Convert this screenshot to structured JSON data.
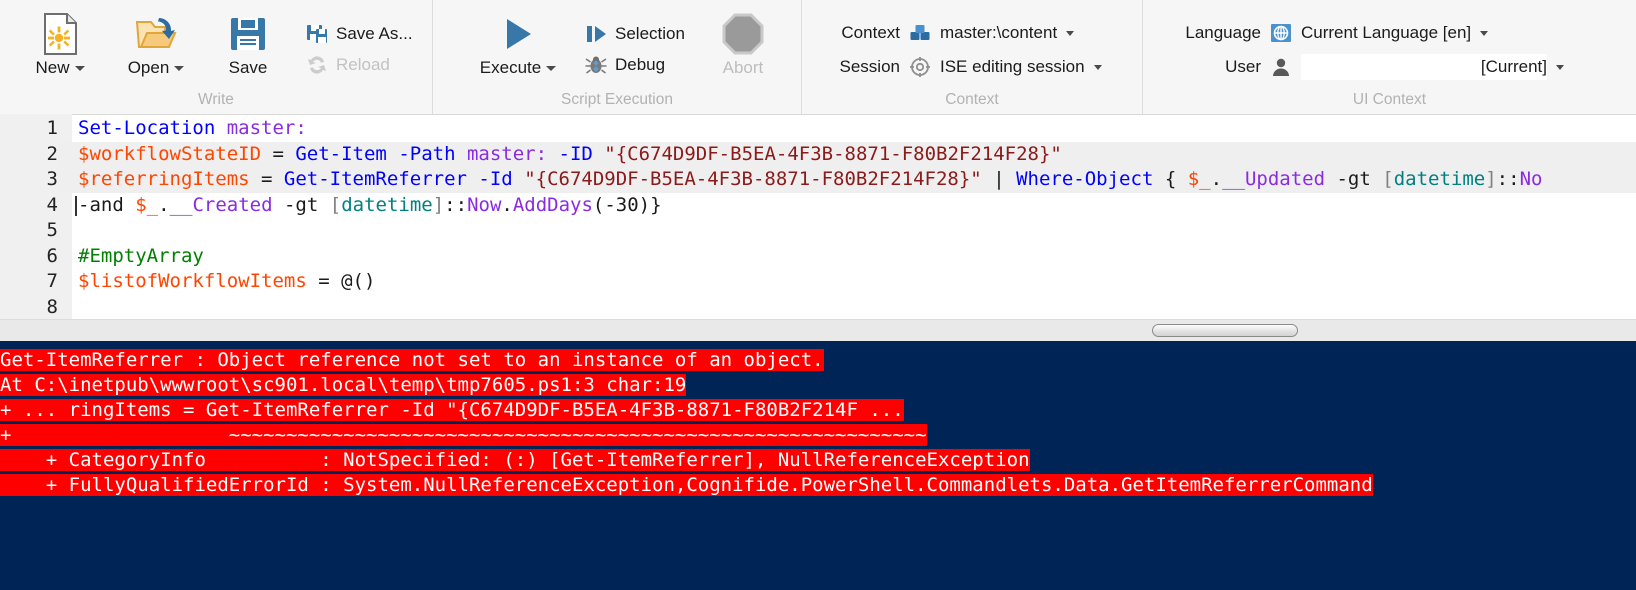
{
  "ribbon": {
    "groups": [
      {
        "name": "write",
        "label": "Write",
        "big_buttons": [
          {
            "caption": "New",
            "icon": "new-file-icon",
            "has_caret": true
          },
          {
            "caption": "Open",
            "icon": "open-folder-icon",
            "has_caret": true
          },
          {
            "caption": "Save",
            "icon": "save-disk-icon",
            "has_caret": false
          }
        ],
        "small_buttons": [
          {
            "caption": "Save As...",
            "icon": "save-as-icon",
            "disabled": false
          },
          {
            "caption": "Reload",
            "icon": "reload-icon",
            "disabled": true
          }
        ]
      },
      {
        "name": "script-execution",
        "label": "Script Execution",
        "big_buttons": [
          {
            "caption": "Execute",
            "icon": "play-icon",
            "has_caret": true
          }
        ],
        "small_buttons": [
          {
            "caption": "Selection",
            "icon": "selection-icon",
            "disabled": false
          },
          {
            "caption": "Debug",
            "icon": "bug-icon",
            "disabled": false
          }
        ],
        "abort": {
          "caption": "Abort",
          "icon": "abort-octagon-icon",
          "disabled": true
        }
      },
      {
        "name": "context",
        "label": "Context",
        "rows": [
          {
            "label": "Context",
            "icon": "database-blocks-icon",
            "value": "master:\\content",
            "has_caret": true
          },
          {
            "label": "Session",
            "icon": "target-icon",
            "value": "ISE editing session",
            "has_caret": true
          }
        ]
      },
      {
        "name": "ui-context",
        "label": "UI Context",
        "rows": [
          {
            "label": "Language",
            "icon": "globe-icon",
            "value": "Current Language [en]",
            "has_caret": true
          },
          {
            "label": "User",
            "icon": "user-icon",
            "value": "[Current]",
            "has_caret": true
          }
        ]
      }
    ]
  },
  "editor": {
    "lines": [
      {
        "number": "1",
        "highlight": false,
        "tokens": [
          {
            "t": "Set-Location",
            "c": "t-cmd"
          },
          {
            "t": " ",
            "c": "t-op"
          },
          {
            "t": "master:",
            "c": "t-par"
          }
        ]
      },
      {
        "number": "2",
        "highlight": true,
        "tokens": [
          {
            "t": "$workflowStateID",
            "c": "t-var"
          },
          {
            "t": " = ",
            "c": "t-op"
          },
          {
            "t": "Get-Item",
            "c": "t-cmd"
          },
          {
            "t": " ",
            "c": "t-op"
          },
          {
            "t": "-Path",
            "c": "t-cmd"
          },
          {
            "t": " ",
            "c": "t-op"
          },
          {
            "t": "master:",
            "c": "t-par"
          },
          {
            "t": " ",
            "c": "t-op"
          },
          {
            "t": "-ID",
            "c": "t-cmd"
          },
          {
            "t": " ",
            "c": "t-op"
          },
          {
            "t": "\"{C674D9DF-B5EA-4F3B-8871-F80B2F214F28}\"",
            "c": "t-str"
          }
        ]
      },
      {
        "number": "3",
        "highlight": true,
        "tokens": [
          {
            "t": "$referringItems",
            "c": "t-var"
          },
          {
            "t": " = ",
            "c": "t-op"
          },
          {
            "t": "Get-ItemReferrer",
            "c": "t-cmd"
          },
          {
            "t": " ",
            "c": "t-op"
          },
          {
            "t": "-Id",
            "c": "t-cmd"
          },
          {
            "t": " ",
            "c": "t-op"
          },
          {
            "t": "\"{C674D9DF-B5EA-4F3B-8871-F80B2F214F28}\"",
            "c": "t-str"
          },
          {
            "t": " ",
            "c": "t-op"
          },
          {
            "t": "|",
            "c": "t-pipe"
          },
          {
            "t": " ",
            "c": "t-op"
          },
          {
            "t": "Where-Object",
            "c": "t-cmd"
          },
          {
            "t": " { ",
            "c": "t-op"
          },
          {
            "t": "$_",
            "c": "t-var"
          },
          {
            "t": ".",
            "c": "t-op"
          },
          {
            "t": "__Updated",
            "c": "t-par"
          },
          {
            "t": " ",
            "c": "t-op"
          },
          {
            "t": "-gt",
            "c": "t-op"
          },
          {
            "t": " ",
            "c": "t-op"
          },
          {
            "t": "[",
            "c": "t-brk"
          },
          {
            "t": "datetime",
            "c": "t-type"
          },
          {
            "t": "]",
            "c": "t-brk"
          },
          {
            "t": "::",
            "c": "t-op"
          },
          {
            "t": "No",
            "c": "t-par"
          }
        ]
      },
      {
        "number": "4",
        "highlight": false,
        "tokens": [
          {
            "t": "-and",
            "c": "t-op"
          },
          {
            "t": " ",
            "c": "t-op"
          },
          {
            "t": "$_",
            "c": "t-var"
          },
          {
            "t": ".",
            "c": "t-op"
          },
          {
            "t": "__Created",
            "c": "t-par"
          },
          {
            "t": " ",
            "c": "t-op"
          },
          {
            "t": "-gt",
            "c": "t-op"
          },
          {
            "t": " ",
            "c": "t-op"
          },
          {
            "t": "[",
            "c": "t-brk"
          },
          {
            "t": "datetime",
            "c": "t-type"
          },
          {
            "t": "]",
            "c": "t-brk"
          },
          {
            "t": "::",
            "c": "t-op"
          },
          {
            "t": "Now",
            "c": "t-par"
          },
          {
            "t": ".",
            "c": "t-op"
          },
          {
            "t": "AddDays",
            "c": "t-par"
          },
          {
            "t": "(-30)}",
            "c": "t-op"
          }
        ]
      },
      {
        "number": "5",
        "highlight": false,
        "tokens": []
      },
      {
        "number": "6",
        "highlight": false,
        "tokens": [
          {
            "t": "#EmptyArray",
            "c": "t-com"
          }
        ]
      },
      {
        "number": "7",
        "highlight": false,
        "tokens": [
          {
            "t": "$listofWorkflowItems",
            "c": "t-var"
          },
          {
            "t": " = ",
            "c": "t-op"
          },
          {
            "t": "@()",
            "c": "t-op"
          }
        ]
      },
      {
        "number": "8",
        "highlight": false,
        "tokens": []
      }
    ]
  },
  "console": {
    "background_color": "#012456",
    "error_background_color": "#ff0000",
    "error_text_color": "#ffffff",
    "lines": [
      "Get-ItemReferrer : Object reference not set to an instance of an object.",
      "At C:\\inetpub\\wwwroot\\sc901.local\\temp\\tmp7605.ps1:3 char:19",
      "+ ... ringItems = Get-ItemReferrer -Id \"{C674D9DF-B5EA-4F3B-8871-F80B2F214F ...",
      "+                   ~~~~~~~~~~~~~~~~~~~~~~~~~~~~~~~~~~~~~~~~~~~~~~~~~~~~~~~~~~~~~",
      "    + CategoryInfo          : NotSpecified: (:) [Get-ItemReferrer], NullReferenceException",
      "    + FullyQualifiedErrorId : System.NullReferenceException,Cognifide.PowerShell.Commandlets.Data.GetItemReferrerCommand"
    ]
  }
}
